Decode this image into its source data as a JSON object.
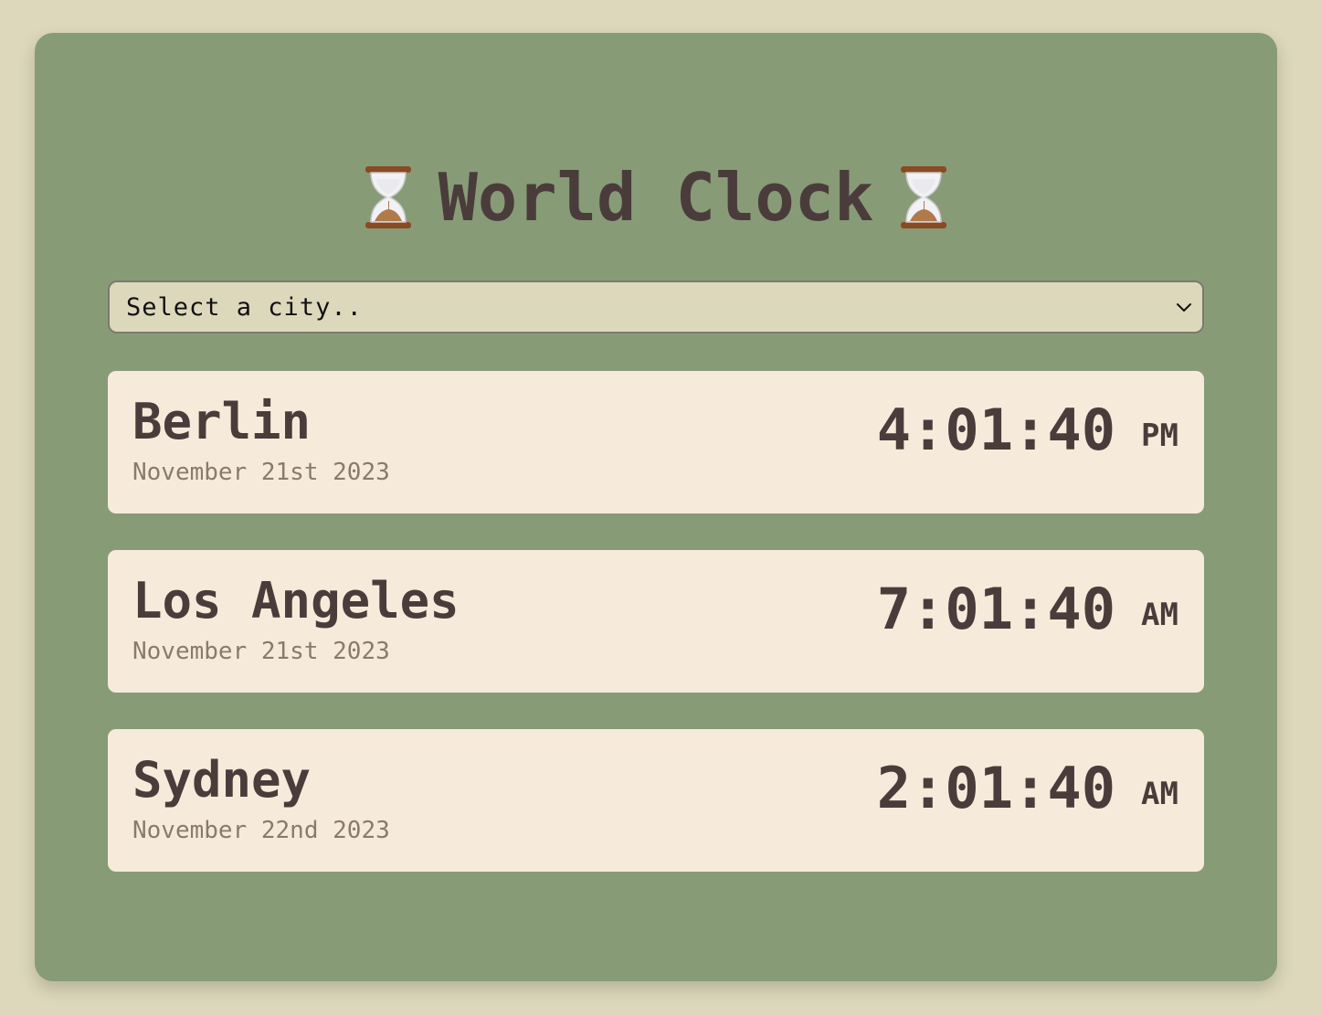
{
  "app": {
    "title": "World Clock",
    "title_icon": "hourglass-icon"
  },
  "colors": {
    "page_background": "#ddd8bb",
    "card_background": "#889b77",
    "city_card_background": "#f6ebda",
    "text_dark": "#4b3c3c",
    "text_muted": "#8a7a6e"
  },
  "city_select": {
    "selected_label": "Select a city..",
    "icon": "chevron-down-icon"
  },
  "cities": [
    {
      "name": "Berlin",
      "date": "November 21st 2023",
      "time": "4:01:40",
      "ampm": "PM"
    },
    {
      "name": "Los Angeles",
      "date": "November 21st 2023",
      "time": "7:01:40",
      "ampm": "AM"
    },
    {
      "name": "Sydney",
      "date": "November 22nd 2023",
      "time": "2:01:40",
      "ampm": "AM"
    }
  ]
}
